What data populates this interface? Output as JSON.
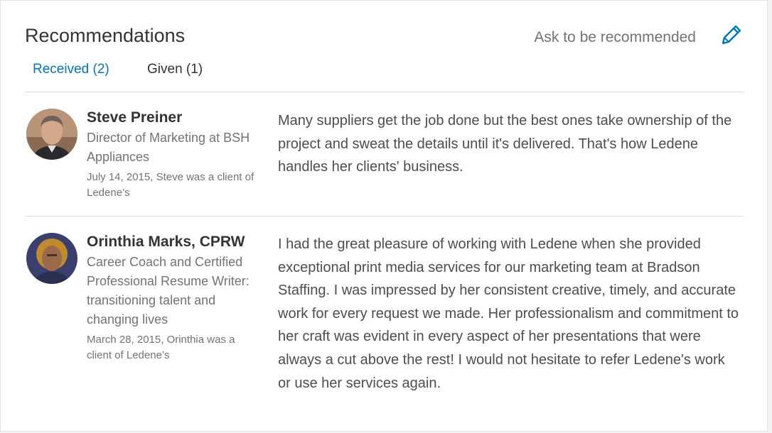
{
  "section": {
    "title": "Recommendations",
    "ask_label": "Ask to be recommended",
    "edit_icon": "pencil-icon"
  },
  "tabs": [
    {
      "label": "Received (2)",
      "active": true
    },
    {
      "label": "Given (1)",
      "active": false
    }
  ],
  "colors": {
    "accent": "#0077b5",
    "text_primary": "#333333",
    "text_secondary": "#737373",
    "divider": "#dddddd"
  },
  "recommendations": [
    {
      "name": "Steve Preiner",
      "headline": "Director of Marketing at BSH Appliances",
      "meta": "July 14, 2015, Steve was a client of Ledene’s",
      "text": "Many suppliers get the job done but the best ones take ownership of the project and sweat the details until it's delivered. That's how Ledene handles her clients' business.",
      "avatar_icon": "avatar"
    },
    {
      "name": "Orinthia Marks, CPRW",
      "headline": "Career Coach and Certified Professional Resume Writer: transitioning talent and changing lives",
      "meta": "March 28, 2015, Orinthia was a client of Ledene’s",
      "text": "I had the great pleasure of working with Ledene when she provided exceptional print media services for our marketing team at Bradson Staffing. I was impressed by her consistent creative, timely, and accurate work for every request we made. Her professionalism and commitment to her craft was evident in every aspect of her presentations that were always a cut above the rest! I would not hesitate to refer Ledene's work or use her services again.",
      "avatar_icon": "avatar"
    }
  ]
}
